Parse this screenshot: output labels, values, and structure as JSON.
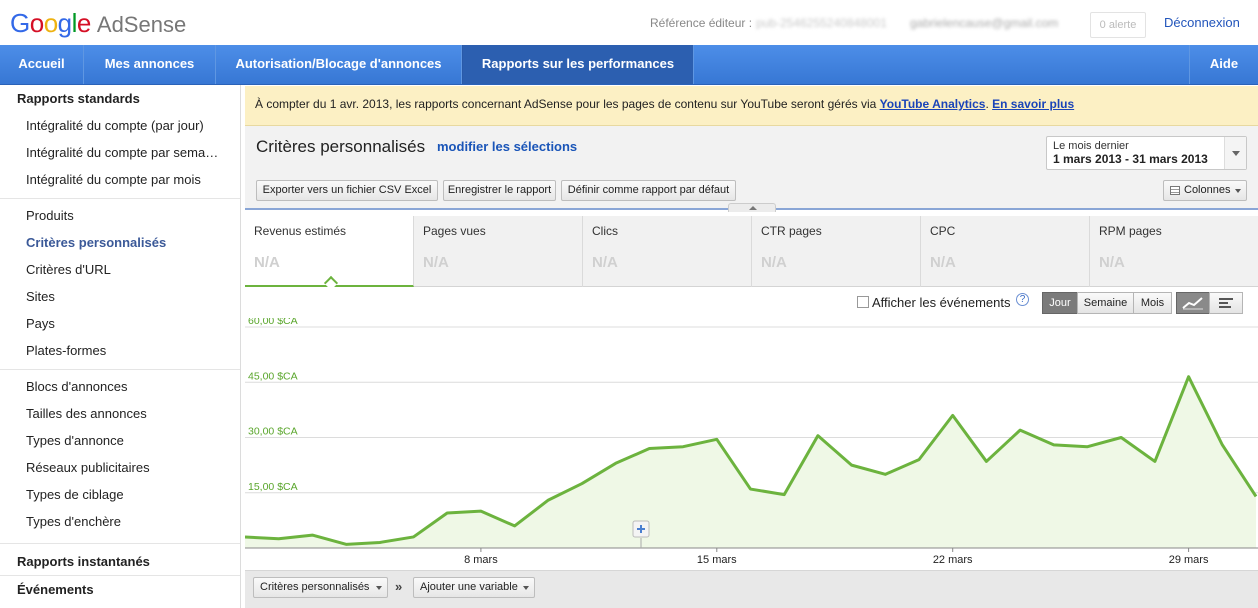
{
  "header": {
    "logo_google": "Google",
    "logo_product": "AdSense",
    "publisher_ref_label": "Référence éditeur :",
    "publisher_id": "pub-2546255240848001",
    "email": "gabrielencause@gmail.com",
    "alerts": "0 alerte",
    "logout": "Déconnexion"
  },
  "nav": {
    "items": [
      "Accueil",
      "Mes annonces",
      "Autorisation/Blocage d'annonces",
      "Rapports sur les performances"
    ],
    "help": "Aide"
  },
  "sidebar": {
    "standard_reports": "Rapports standards",
    "group1": [
      "Intégralité du compte (par jour)",
      "Intégralité du compte par sema…",
      "Intégralité du compte par mois"
    ],
    "group2": [
      "Produits",
      "Critères personnalisés",
      "Critères d'URL",
      "Sites",
      "Pays",
      "Plates-formes"
    ],
    "group3": [
      "Blocs d'annonces",
      "Tailles des annonces",
      "Types d'annonce",
      "Réseaux publicitaires",
      "Types de ciblage",
      "Types d'enchère"
    ],
    "instant_reports": "Rapports instantanés",
    "events": "Événements"
  },
  "notice": {
    "text": "À compter du 1 avr. 2013, les rapports concernant AdSense pour les pages de contenu sur YouTube seront gérés via",
    "link1": "YouTube Analytics",
    "sep": ".",
    "link2": "En savoir plus"
  },
  "report": {
    "title": "Critères personnalisés",
    "edit_link": "modifier les sélections",
    "date_label": "Le mois dernier",
    "date_range": "1 mars 2013 - 31 mars 2013",
    "export_csv": "Exporter vers un fichier CSV Excel",
    "save_report": "Enregistrer le rapport",
    "set_default": "Définir comme rapport par défaut",
    "columns": "Colonnes"
  },
  "metrics": [
    {
      "name": "Revenus estimés",
      "value": "N/A"
    },
    {
      "name": "Pages vues",
      "value": "N/A"
    },
    {
      "name": "Clics",
      "value": "N/A"
    },
    {
      "name": "CTR pages",
      "value": "N/A"
    },
    {
      "name": "CPC",
      "value": "N/A"
    },
    {
      "name": "RPM pages",
      "value": "N/A"
    }
  ],
  "chart_toolbar": {
    "show_events": "Afficher les événements",
    "help": "?",
    "day": "Jour",
    "week": "Semaine",
    "month": "Mois"
  },
  "chart_data": {
    "type": "area",
    "x": [
      1,
      2,
      3,
      4,
      5,
      6,
      7,
      8,
      9,
      10,
      11,
      12,
      13,
      14,
      15,
      16,
      17,
      18,
      19,
      20,
      21,
      22,
      23,
      24,
      25,
      26,
      27,
      28,
      29,
      30,
      31
    ],
    "x_tick_values": [
      8,
      15,
      22,
      29
    ],
    "x_tick_labels": [
      "8 mars",
      "15 mars",
      "22 mars",
      "29 mars"
    ],
    "y_ticks": [
      15,
      30,
      45,
      60
    ],
    "y_tick_labels": [
      "15,00 $CA",
      "30,00 $CA",
      "45,00 $CA",
      "60,00 $CA"
    ],
    "ylim": [
      0,
      60
    ],
    "series": [
      {
        "values": [
          3,
          2.5,
          3.5,
          1,
          1.5,
          3,
          9.5,
          10,
          6,
          13,
          17.5,
          23,
          27,
          27.5,
          29.5,
          16,
          14.5,
          30.5,
          22.5,
          20,
          24,
          36,
          23.5,
          32,
          28,
          27.5,
          30,
          23.5,
          46.5,
          28,
          14
        ]
      }
    ],
    "line_color": "#6cb33e",
    "fill_color": "#eff8e6",
    "grid": true
  },
  "bottom_toolbar": {
    "dim1": "Critères personnalisés",
    "chevron": "»",
    "add_variable": "Ajouter une variable"
  }
}
